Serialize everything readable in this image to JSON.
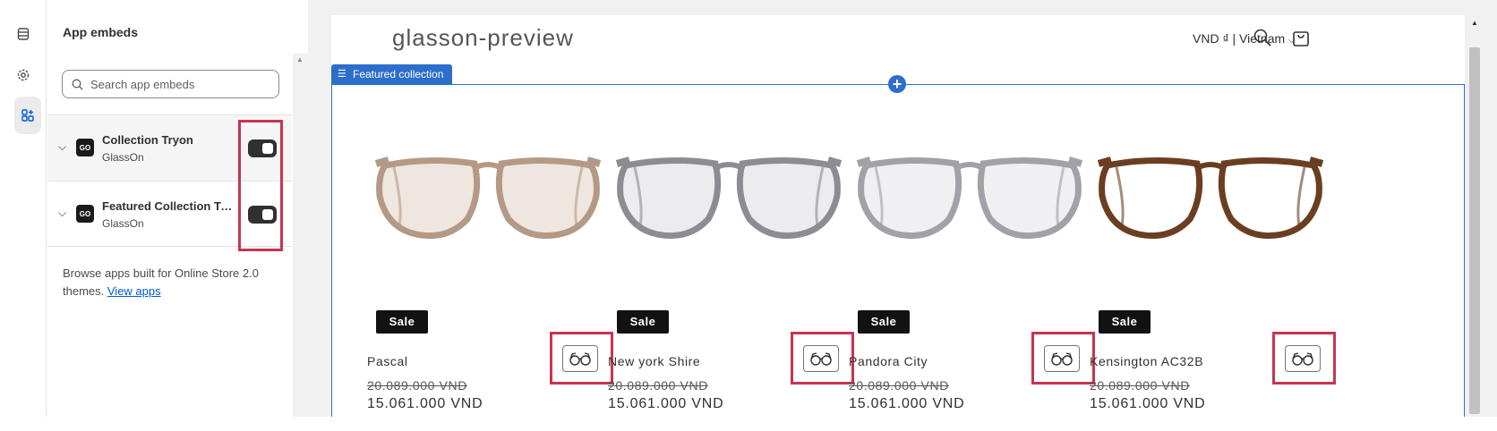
{
  "rail": {
    "icons": [
      "sections-icon",
      "gear-icon",
      "app-embeds-icon"
    ]
  },
  "panel": {
    "title": "App embeds",
    "search_placeholder": "Search app embeds",
    "embeds": [
      {
        "name": "Collection Tryon",
        "vendor": "GlassOn",
        "logo": "GO",
        "enabled": true
      },
      {
        "name": "Featured Collection Tryon",
        "vendor": "GlassOn",
        "logo": "GO",
        "enabled": true
      }
    ],
    "browse_text": "Browse apps built for Online Store 2.0 themes.",
    "view_apps": "View apps"
  },
  "store": {
    "name": "glasson-preview",
    "currency": "VND ₫ | Vietnam",
    "section_label": "Featured collection",
    "products": [
      {
        "name": "Pascal",
        "badge": "Sale",
        "old_price": "20.089.000 VND",
        "price": "15.061.000 VND",
        "frame_color": "#b49a86",
        "lens_tint": "#efe7df"
      },
      {
        "name": "New york Shire",
        "badge": "Sale",
        "old_price": "20.089.000 VND",
        "price": "15.061.000 VND",
        "frame_color": "#8f8b93",
        "lens_tint": "#ececee"
      },
      {
        "name": "Pandora City",
        "badge": "Sale",
        "old_price": "20.089.000 VND",
        "price": "15.061.000 VND",
        "frame_color": "#a3a0a8",
        "lens_tint": "#f0eff2"
      },
      {
        "name": "Kensington AC32B",
        "badge": "Sale",
        "old_price": "20.089.000 VND",
        "price": "15.061.000 VND",
        "frame_color": "#6b3e22",
        "lens_tint": "#ffffff"
      }
    ]
  },
  "colors": {
    "accent": "#2c6ecb",
    "highlight": "#c8344f",
    "toggle_on": "#303030"
  }
}
